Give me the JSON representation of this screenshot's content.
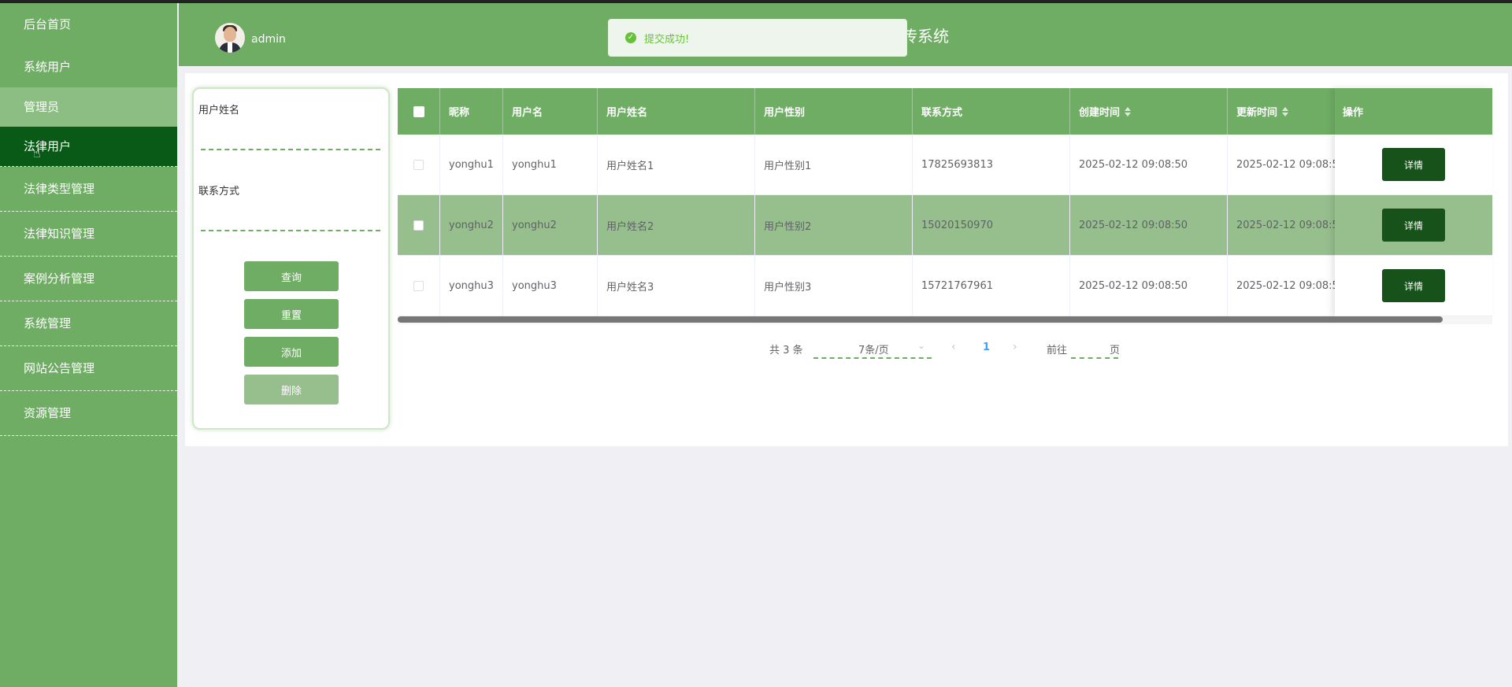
{
  "sidebar": {
    "items": [
      {
        "label": "后台首页"
      },
      {
        "label": "系统用户"
      },
      {
        "label": "管理员"
      },
      {
        "label": "法律用户"
      },
      {
        "label": "法律类型管理"
      },
      {
        "label": "法律知识管理"
      },
      {
        "label": "案例分析管理"
      },
      {
        "label": "系统管理"
      },
      {
        "label": "网站公告管理"
      },
      {
        "label": "资源管理"
      }
    ]
  },
  "header": {
    "username": "admin",
    "system_title": "传系统"
  },
  "toast": {
    "message": "提交成功!",
    "color": "#67c23a"
  },
  "search": {
    "name_label": "用户姓名",
    "name_value": "",
    "phone_label": "联系方式",
    "phone_value": "",
    "query_label": "查询",
    "reset_label": "重置",
    "add_label": "添加",
    "delete_label": "删除"
  },
  "table": {
    "columns": {
      "nickname": "昵称",
      "username": "用户名",
      "realname": "用户姓名",
      "gender": "用户性别",
      "phone": "联系方式",
      "created": "创建时间",
      "updated": "更新时间",
      "op": "操作"
    },
    "rows": [
      {
        "nickname": "yonghu1",
        "username": "yonghu1",
        "realname": "用户姓名1",
        "gender": "用户性别1",
        "phone": "17825693813",
        "created": "2025-02-12 09:08:50",
        "updated": "2025-02-12 09:08:5"
      },
      {
        "nickname": "yonghu2",
        "username": "yonghu2",
        "realname": "用户姓名2",
        "gender": "用户性别2",
        "phone": "15020150970",
        "created": "2025-02-12 09:08:50",
        "updated": "2025-02-12 09:08:5"
      },
      {
        "nickname": "yonghu3",
        "username": "yonghu3",
        "realname": "用户姓名3",
        "gender": "用户性别3",
        "phone": "15721767961",
        "created": "2025-02-12 09:08:50",
        "updated": "2025-02-12 09:08:5"
      }
    ],
    "detail_label": "详情"
  },
  "pagination": {
    "total": "共 3 条",
    "page_size": "7条/页",
    "prev": "‹",
    "current_page": "1",
    "next": "›",
    "goto_label": "前往",
    "goto_value": "",
    "page_unit": "页"
  },
  "colors": {
    "primary": "#6fad64",
    "sidebar_active": "#085a16",
    "detail_button": "#17521a",
    "row_highlight": "#96bf8d"
  },
  "icons": {
    "toast": "check-circle-icon",
    "sort": "sort-caret-icon",
    "dropdown": "chevron-down-icon",
    "cursor": "hand-pointer-icon"
  }
}
